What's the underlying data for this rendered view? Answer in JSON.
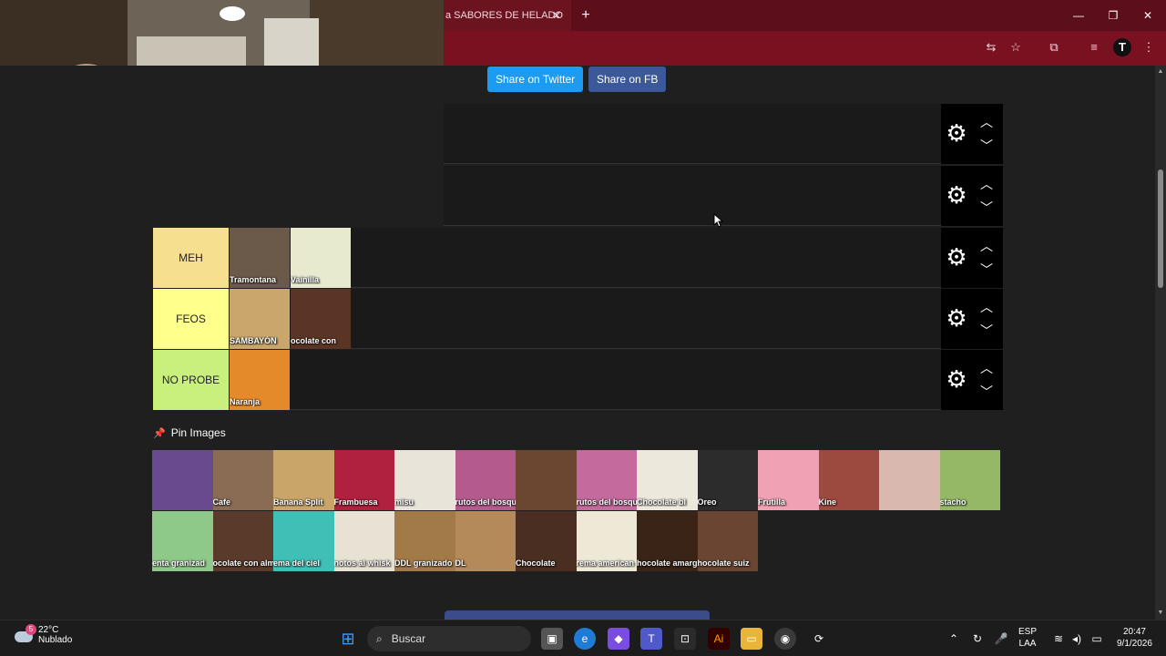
{
  "browser": {
    "tab_title": "a SABORES DE HELADO",
    "tab_close": "✕",
    "new_tab": "+",
    "minimize": "—",
    "maximize": "❐",
    "close": "✕",
    "avatar_letter": "T"
  },
  "share": {
    "twitter_label": "Share on Twitter",
    "fb_label": "Share on FB"
  },
  "tiers": [
    {
      "label": "",
      "color": "#1a1a1a",
      "items": []
    },
    {
      "label": "",
      "color": "#1a1a1a",
      "items": []
    },
    {
      "label": "MEH",
      "color": "#f7df90",
      "items": [
        {
          "label": "Tramontana",
          "color": "#6b5a4a"
        },
        {
          "label": "Vainilla",
          "color": "#e8ead0"
        }
      ]
    },
    {
      "label": "FEOS",
      "color": "#ffff8c",
      "items": [
        {
          "label": "SAMBAYÓN",
          "color": "#c9a66b"
        },
        {
          "label": "ocolate con",
          "color": "#5a3526"
        }
      ]
    },
    {
      "label": "NO PROBE",
      "color": "#c9f07c",
      "items": [
        {
          "label": "Naranja",
          "color": "#e58a2a"
        }
      ]
    }
  ],
  "pin_images": {
    "title": "Pin Images",
    "icon": "📌"
  },
  "pool": [
    {
      "label": "",
      "color": "#6a4a8f"
    },
    {
      "label": "Cafe",
      "color": "#8a6c54"
    },
    {
      "label": "Banana Split",
      "color": "#c9a56a"
    },
    {
      "label": "Frambuesa",
      "color": "#b0213f"
    },
    {
      "label": "misu",
      "color": "#e9e4da"
    },
    {
      "label": "rutos del bosqu",
      "color": "#b45a8c"
    },
    {
      "label": "",
      "color": "#6b4630"
    },
    {
      "label": "rutos del bosqu",
      "color": "#c46a9c"
    },
    {
      "label": "Chocolate bl",
      "color": "#ece8dc"
    },
    {
      "label": "Oreo",
      "color": "#2c2c2c"
    },
    {
      "label": "Frutilla",
      "color": "#f0a2b4"
    },
    {
      "label": "Kine",
      "color": "#9c4a3f"
    },
    {
      "label": "",
      "color": "#d9b8b0"
    },
    {
      "label": "stacho",
      "color": "#95b866"
    },
    {
      "label": "enta granizad",
      "color": "#8fc98a"
    },
    {
      "label": "ocolate con almend",
      "color": "#5a3a2a"
    },
    {
      "label": "ema del ciel",
      "color": "#3fbfb5"
    },
    {
      "label": "notos al whisk",
      "color": "#e7e2d4"
    },
    {
      "label": "DDL granizado",
      "color": "#a27a48"
    },
    {
      "label": "DL",
      "color": "#b48a5a"
    },
    {
      "label": "Chocolate",
      "color": "#4a2e22"
    },
    {
      "label": "rema american",
      "color": "#eee9d6"
    },
    {
      "label": "hocolate amarg",
      "color": "#3a2418"
    },
    {
      "label": "hocolate suiz",
      "color": "#6a4632"
    }
  ],
  "taskbar": {
    "temp": "22°C",
    "condition": "Nublado",
    "search_placeholder": "Buscar",
    "lang_top": "ESP",
    "lang_bottom": "LAA",
    "time": "20:47",
    "date": "9/1/2026",
    "weather_badge": "5"
  }
}
